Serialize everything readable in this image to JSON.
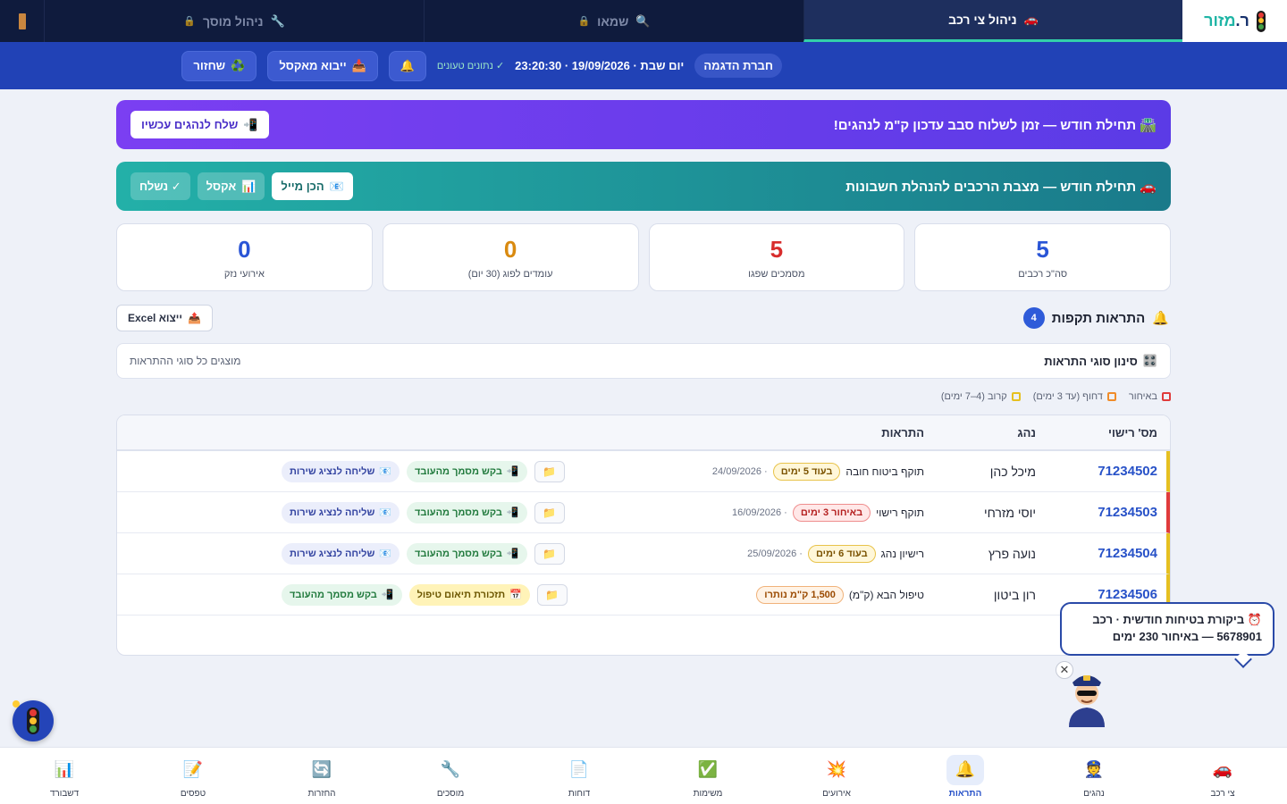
{
  "brand": {
    "name_part1": "ר.",
    "name_part2": "מזור"
  },
  "tabs": [
    {
      "label": "ניהול צי רכב",
      "icon": "🚗",
      "active": true
    },
    {
      "label": "שמאו",
      "icon": "🔍",
      "locked": true
    },
    {
      "label": "ניהול מוסך",
      "icon": "🔧",
      "locked": true
    }
  ],
  "toolbar": {
    "company": "חברת הדגמה",
    "datetime": "יום שבת · 19/09/2026 · 23:20:30",
    "data_loaded": "✓ נתונים טעונים",
    "bell_icon": "🔔",
    "import_label": "ייבוא מאקסל",
    "import_icon": "📥",
    "restore_label": "שחזור",
    "restore_icon": "♻️"
  },
  "banner_km": {
    "icon": "🛣️",
    "text": "תחילת חודש — זמן לשלוח סבב עדכון ק\"מ לנהגים!",
    "button_label": "שלח לנהגים עכשיו",
    "button_icon": "📲"
  },
  "banner_fleet": {
    "icon": "🚗",
    "text": "תחילת חודש — מצבת הרכבים להנהלת חשבונות",
    "btn_mail": "הכן מייל",
    "btn_mail_icon": "📧",
    "btn_excel": "אקסל",
    "btn_excel_icon": "📊",
    "btn_sent": "✓ נשלח"
  },
  "stats": [
    {
      "value": "5",
      "label": "סה\"כ רכבים",
      "color": "#2a55d6"
    },
    {
      "value": "5",
      "label": "מסמכים שפגו",
      "color": "#d82c2c"
    },
    {
      "value": "0",
      "label": "עומדים לפוג (30 יום)",
      "color": "#d98a10"
    },
    {
      "value": "0",
      "label": "אירועי נזק",
      "color": "#2a55d6"
    }
  ],
  "alerts": {
    "title": "התראות תקפות",
    "bell_icon": "🔔",
    "count": "4",
    "export_label": "ייצוא Excel",
    "export_icon": "📤",
    "filter_title": "סינון סוגי התראות",
    "filter_icon": "🎛️",
    "filter_status": "מוצגים כל סוגי ההתראות",
    "legend": [
      {
        "label": "באיחור",
        "color": "#e03b3b"
      },
      {
        "label": "דחוף (עד 3 ימים)",
        "color": "#f08c2a"
      },
      {
        "label": "קרוב (4–7 ימים)",
        "color": "#e6c020"
      }
    ],
    "columns": {
      "plate": "מס' רישוי",
      "driver": "נהג",
      "alerts": "התראות"
    },
    "rows": [
      {
        "plate": "71234502",
        "driver": "מיכל כהן",
        "alert": "תוקף ביטוח חובה",
        "pill": "בעוד 5 ימים",
        "pill_class": "y",
        "date": "· 24/09/2026",
        "border": "#e6c020",
        "actions": [
          {
            "label": "שליחה לנציג שירות",
            "icon": "📧",
            "cls": "blue"
          },
          {
            "label": "בקש מסמך מהעובד",
            "icon": "📲",
            "cls": "green"
          }
        ]
      },
      {
        "plate": "71234503",
        "driver": "יוסי מזרחי",
        "alert": "תוקף רישוי",
        "pill": "באיחור 3 ימים",
        "pill_class": "r",
        "date": "· 16/09/2026",
        "border": "#e03b3b",
        "actions": [
          {
            "label": "שליחה לנציג שירות",
            "icon": "📧",
            "cls": "blue"
          },
          {
            "label": "בקש מסמך מהעובד",
            "icon": "📲",
            "cls": "green"
          }
        ]
      },
      {
        "plate": "71234504",
        "driver": "נועה פרץ",
        "alert": "רישיון נהג",
        "pill": "בעוד 6 ימים",
        "pill_class": "y",
        "date": "· 25/09/2026",
        "border": "#e6c020",
        "actions": [
          {
            "label": "שליחה לנציג שירות",
            "icon": "📧",
            "cls": "blue"
          },
          {
            "label": "בקש מסמך מהעובד",
            "icon": "📲",
            "cls": "green"
          }
        ]
      },
      {
        "plate": "71234506",
        "driver": "רון ביטון",
        "alert": "טיפול הבא (ק\"מ)",
        "pill": "1,500 ק\"מ נותרו",
        "pill_class": "o",
        "date": "",
        "border": "#e6c020",
        "actions": [
          {
            "label": "בקש מסמך מהעובד",
            "icon": "📲",
            "cls": "green"
          },
          {
            "label": "תזכורת תיאום טיפול",
            "icon": "📅",
            "cls": "yellow"
          }
        ]
      }
    ]
  },
  "assistant": {
    "icon": "⏰",
    "line1": "ביקורת בטיחות חודשית · רכב",
    "line2": "5678901 — באיחור 230 ימים",
    "close": "✕"
  },
  "bottom_nav": [
    {
      "label": "צי רכב",
      "icon": "🚗"
    },
    {
      "label": "נהגים",
      "icon": "👮"
    },
    {
      "label": "התראות",
      "icon": "🔔",
      "active": true
    },
    {
      "label": "אירועים",
      "icon": "💥"
    },
    {
      "label": "משימות",
      "icon": "✅"
    },
    {
      "label": "דוחות",
      "icon": "📄"
    },
    {
      "label": "מוסכים",
      "icon": "🔧"
    },
    {
      "label": "החזרות",
      "icon": "🔄"
    },
    {
      "label": "טפסים",
      "icon": "📝"
    },
    {
      "label": "דשבורד",
      "icon": "📊"
    }
  ]
}
